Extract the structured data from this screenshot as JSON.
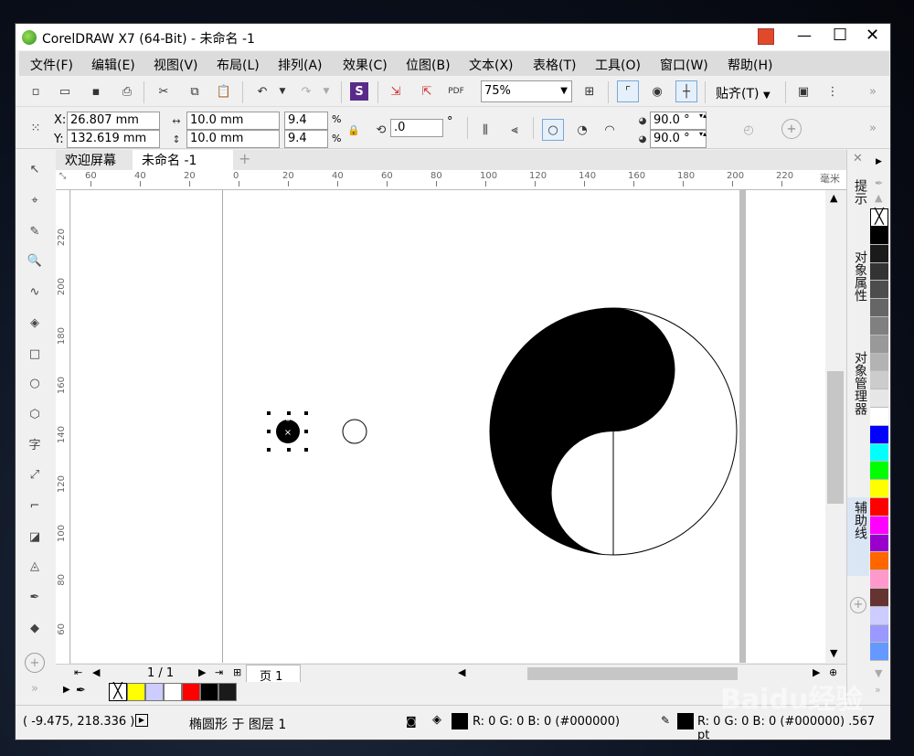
{
  "window": {
    "title": "CorelDRAW X7 (64-Bit) - 未命名 -1",
    "controls": {
      "minimize": "—",
      "maximize": "☐",
      "close": "✕"
    }
  },
  "menu": [
    "文件(F)",
    "编辑(E)",
    "视图(V)",
    "布局(L)",
    "排列(A)",
    "效果(C)",
    "位图(B)",
    "文本(X)",
    "表格(T)",
    "工具(O)",
    "窗口(W)",
    "帮助(H)"
  ],
  "toolbar": {
    "zoom": "75%",
    "snap": "贴齐(T)"
  },
  "props": {
    "x": "26.807 mm",
    "y": "132.619 mm",
    "w": "10.0 mm",
    "h": "10.0 mm",
    "sx": "9.4",
    "sy": "9.4",
    "pct": "%",
    "angle": ".0",
    "deg": "°",
    "x_label": "X:",
    "y_label": "Y:",
    "ang1": "90.0 °",
    "ang2": "90.0 °"
  },
  "tabs": {
    "welcome": "欢迎屏幕",
    "doc": "未命名 -1",
    "add": "+"
  },
  "ruler": {
    "unit": "毫米",
    "h": [
      "60",
      "40",
      "20",
      "0",
      "20",
      "40",
      "60",
      "80",
      "100",
      "120",
      "140",
      "160",
      "180",
      "200",
      "220"
    ],
    "v": [
      "220",
      "200",
      "180",
      "160",
      "140",
      "120",
      "100",
      "80",
      "60"
    ]
  },
  "dockers": {
    "hints": "提示",
    "obj_props": "对象属性",
    "obj_mgr": "对象管理器",
    "guides": "辅助线"
  },
  "pagenav": {
    "count": "1 / 1",
    "page": "页 1"
  },
  "status": {
    "coords": "( -9.475, 218.336 )",
    "object": "椭圆形 于 图层 1",
    "fill": "R: 0 G: 0 B: 0 (#000000)",
    "outline": "R: 0 G: 0 B: 0 (#000000)  .567 pt"
  },
  "palette": {
    "right": [
      "#000000",
      "#1a1a1a",
      "#333333",
      "#4d4d4d",
      "#666666",
      "#808080",
      "#999999",
      "#b3b3b3",
      "#cccccc",
      "#e6e6e6",
      "#ffffff",
      "#0000ff",
      "#00ffff",
      "#00ff00",
      "#ffff00",
      "#ff0000",
      "#ff00ff",
      "#9900cc",
      "#ff6600",
      "#ff99cc",
      "#663333",
      "#ccccff",
      "#9999ff",
      "#6699ff"
    ],
    "doc": [
      "#ffff00",
      "#ccccff",
      "#ffffff",
      "#ff0000",
      "#000000",
      "#1a1a1a"
    ]
  },
  "watermark": "Baidu经验"
}
